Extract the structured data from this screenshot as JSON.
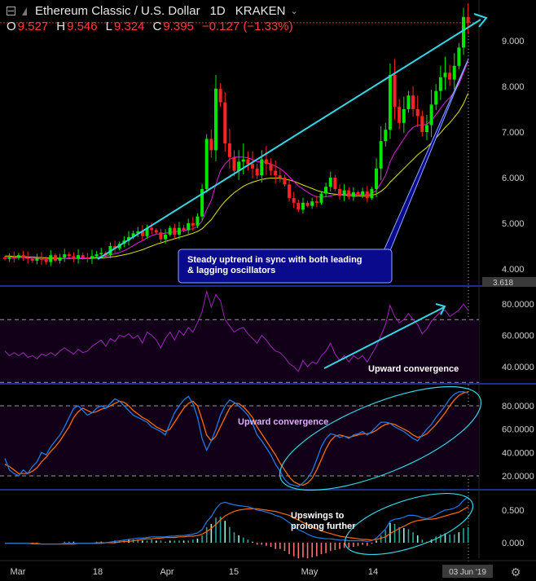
{
  "header": {
    "symbol_title": "Ethereum Classic / U.S. Dollar",
    "timeframe": "1D",
    "exchange": "KRAKEN",
    "ohlc": {
      "o_label": "O",
      "o_value": "9.527",
      "h_label": "H",
      "h_value": "9.546",
      "l_label": "L",
      "l_value": "9.324",
      "c_label": "C",
      "c_value": "9.395",
      "change": "−0.127 (−1.33%)"
    }
  },
  "colors": {
    "up": "#00e600",
    "down": "#ff2222",
    "trendline": "#33d6e6",
    "ma_fast": "#e020e0",
    "ma_slow": "#e6e600",
    "oscillator": "#a020c0",
    "stoch_k": "#1e7ae6",
    "stoch_d": "#ff6a00",
    "macd": "#1e7ae6",
    "signal": "#ff6a00",
    "callout_fill": "#0a0a8c",
    "ellipse": "#33d6e6",
    "annotation_text": "#ffffff"
  },
  "annotations": {
    "price_callout": "Steady uptrend in sync with both leading & lagging oscillators",
    "rsi_note": "Upward convergence",
    "stoch_note": "Upward convergence",
    "macd_note": "Upswings to prolong further"
  },
  "chart_data": [
    {
      "type": "candlestick",
      "title": "Ethereum Classic / U.S. Dollar",
      "x_tick_labels": [
        "Mar",
        "18",
        "Apr",
        "15",
        "May",
        "14",
        "03 Jun '19"
      ],
      "y_ticks": [
        4.0,
        5.0,
        6.0,
        7.0,
        8.0,
        9.0
      ],
      "y_tick_labels": [
        "4.000",
        "5.000",
        "6.000",
        "7.000",
        "8.000",
        "9.000"
      ],
      "ylim": [
        3.58,
        9.88
      ],
      "highlighted_value": "3.618",
      "close": [
        4.22,
        4.26,
        4.24,
        4.3,
        4.25,
        4.22,
        4.18,
        4.23,
        4.2,
        4.15,
        4.3,
        4.18,
        4.25,
        4.32,
        4.28,
        4.22,
        4.3,
        4.25,
        4.22,
        4.28,
        4.32,
        4.35,
        4.3,
        4.5,
        4.45,
        4.55,
        4.62,
        4.7,
        4.78,
        4.82,
        4.72,
        4.9,
        4.85,
        4.8,
        4.65,
        4.75,
        4.9,
        4.75,
        4.9,
        4.85,
        5.0,
        4.95,
        5.15,
        5.75,
        6.85,
        6.6,
        7.95,
        7.65,
        6.75,
        6.45,
        6.15,
        6.35,
        6.4,
        6.3,
        6.2,
        6.05,
        6.4,
        6.3,
        6.15,
        6.05,
        6.0,
        5.85,
        5.55,
        5.45,
        5.3,
        5.45,
        5.38,
        5.48,
        5.45,
        5.65,
        5.8,
        6.0,
        5.75,
        5.6,
        5.72,
        5.58,
        5.68,
        5.62,
        5.7,
        5.55,
        5.75,
        6.2,
        6.8,
        7.05,
        8.25,
        7.55,
        7.2,
        7.5,
        7.8,
        7.5,
        7.35,
        7.0,
        7.15,
        7.6,
        7.9,
        8.2,
        8.3,
        8.15,
        8.45,
        8.85,
        9.52,
        9.395
      ],
      "series": [
        {
          "name": "MA fast",
          "values": [
            4.25,
            4.25,
            4.24,
            4.25,
            4.25,
            4.24,
            4.23,
            4.23,
            4.22,
            4.21,
            4.22,
            4.22,
            4.22,
            4.23,
            4.24,
            4.23,
            4.24,
            4.24,
            4.24,
            4.25,
            4.26,
            4.27,
            4.28,
            4.31,
            4.33,
            4.36,
            4.4,
            4.45,
            4.51,
            4.57,
            4.62,
            4.68,
            4.73,
            4.76,
            4.77,
            4.78,
            4.8,
            4.81,
            4.83,
            4.84,
            4.86,
            4.88,
            4.93,
            5.05,
            5.3,
            5.5,
            5.85,
            6.15,
            6.3,
            6.4,
            6.45,
            6.45,
            6.45,
            6.43,
            6.4,
            6.35,
            6.35,
            6.33,
            6.3,
            6.25,
            6.2,
            6.12,
            6.02,
            5.92,
            5.82,
            5.75,
            5.68,
            5.62,
            5.58,
            5.57,
            5.58,
            5.6,
            5.62,
            5.63,
            5.64,
            5.64,
            5.64,
            5.63,
            5.63,
            5.63,
            5.65,
            5.72,
            5.88,
            6.05,
            6.35,
            6.55,
            6.7,
            6.85,
            7.0,
            7.1,
            7.15,
            7.15,
            7.17,
            7.25,
            7.38,
            7.52,
            7.65,
            7.75,
            7.88,
            8.05,
            8.3,
            8.55
          ]
        },
        {
          "name": "MA slow",
          "values": [
            4.28,
            4.28,
            4.27,
            4.27,
            4.27,
            4.26,
            4.26,
            4.25,
            4.25,
            4.24,
            4.24,
            4.24,
            4.23,
            4.23,
            4.23,
            4.23,
            4.23,
            4.23,
            4.23,
            4.23,
            4.24,
            4.24,
            4.25,
            4.26,
            4.27,
            4.29,
            4.31,
            4.33,
            4.36,
            4.39,
            4.42,
            4.46,
            4.5,
            4.54,
            4.57,
            4.6,
            4.63,
            4.66,
            4.69,
            4.72,
            4.75,
            4.78,
            4.82,
            4.88,
            4.98,
            5.08,
            5.22,
            5.36,
            5.48,
            5.58,
            5.67,
            5.74,
            5.81,
            5.86,
            5.9,
            5.93,
            5.96,
            5.98,
            5.99,
            5.99,
            5.99,
            5.97,
            5.95,
            5.92,
            5.88,
            5.84,
            5.8,
            5.76,
            5.72,
            5.69,
            5.67,
            5.65,
            5.64,
            5.63,
            5.62,
            5.61,
            5.6,
            5.6,
            5.6,
            5.6,
            5.61,
            5.64,
            5.7,
            5.78,
            5.9,
            6.0,
            6.1,
            6.2,
            6.3,
            6.4,
            6.5,
            6.58,
            6.66,
            6.76,
            6.87,
            6.98,
            7.1,
            7.2,
            7.32,
            7.45,
            7.62,
            7.85
          ]
        }
      ]
    },
    {
      "type": "line",
      "title": "",
      "y_tick_labels": [
        "40.0000",
        "60.0000",
        "80.0000"
      ],
      "ylim": [
        30,
        92
      ],
      "bands": [
        30,
        70
      ],
      "series": [
        {
          "name": "",
          "values": [
            50,
            47,
            49,
            47,
            49,
            46,
            47,
            45,
            48,
            47,
            49,
            47,
            50,
            52,
            50,
            48,
            51,
            49,
            50,
            53,
            55,
            57,
            53,
            58,
            56,
            60,
            59,
            61,
            58,
            60,
            55,
            62,
            60,
            57,
            52,
            58,
            62,
            57,
            63,
            60,
            65,
            62,
            68,
            75,
            88,
            78,
            86,
            82,
            70,
            66,
            62,
            64,
            65,
            61,
            58,
            55,
            60,
            57,
            53,
            50,
            49,
            46,
            42,
            40,
            37,
            44,
            40,
            43,
            42,
            47,
            50,
            55,
            48,
            44,
            47,
            43,
            47,
            45,
            47,
            43,
            48,
            53,
            60,
            67,
            79,
            72,
            68,
            70,
            74,
            70,
            67,
            61,
            64,
            69,
            72,
            75,
            76,
            72,
            74,
            76,
            80,
            76
          ]
        }
      ]
    },
    {
      "type": "line",
      "title": "",
      "y_tick_labels": [
        "20.0000",
        "40.0000",
        "60.0000",
        "80.0000"
      ],
      "ylim": [
        10,
        100
      ],
      "bands": [
        20,
        80
      ],
      "series": [
        {
          "name": "%K",
          "values": [
            35,
            25,
            22,
            20,
            25,
            22,
            28,
            32,
            40,
            38,
            45,
            50,
            55,
            62,
            70,
            78,
            80,
            76,
            72,
            74,
            78,
            80,
            78,
            82,
            86,
            84,
            80,
            76,
            72,
            70,
            68,
            66,
            62,
            60,
            58,
            55,
            65,
            74,
            80,
            85,
            88,
            82,
            70,
            52,
            42,
            50,
            60,
            72,
            80,
            85,
            83,
            80,
            76,
            72,
            65,
            55,
            50,
            44,
            38,
            30,
            24,
            17,
            13,
            12,
            11,
            14,
            18,
            24,
            34,
            45,
            52,
            56,
            55,
            53,
            54,
            52,
            55,
            56,
            58,
            55,
            58,
            62,
            66,
            66,
            65,
            62,
            60,
            58,
            55,
            52,
            50,
            55,
            60,
            64,
            70,
            75,
            80,
            86,
            90,
            92,
            92,
            91
          ]
        },
        {
          "name": "%D",
          "values": [
            30,
            28,
            25,
            22,
            22,
            22,
            24,
            27,
            32,
            36,
            41,
            45,
            50,
            56,
            62,
            70,
            75,
            78,
            76,
            74,
            75,
            77,
            78,
            80,
            82,
            84,
            83,
            80,
            76,
            73,
            70,
            68,
            65,
            62,
            60,
            58,
            60,
            66,
            72,
            78,
            82,
            84,
            80,
            68,
            55,
            50,
            54,
            62,
            70,
            78,
            82,
            82,
            79,
            75,
            70,
            62,
            56,
            50,
            44,
            38,
            31,
            25,
            19,
            15,
            13,
            12,
            14,
            18,
            25,
            34,
            43,
            50,
            54,
            55,
            54,
            53,
            54,
            55,
            56,
            56,
            57,
            59,
            62,
            64,
            65,
            64,
            62,
            60,
            58,
            55,
            53,
            54,
            56,
            60,
            64,
            69,
            74,
            80,
            85,
            89,
            91,
            92
          ]
        }
      ]
    },
    {
      "type": "bar",
      "title": "",
      "y_tick_labels": [
        "0.000",
        "0.500"
      ],
      "ylim": [
        -0.18,
        0.82
      ],
      "series": [
        {
          "name": "MACD",
          "values": [
            -0.01,
            -0.01,
            -0.01,
            -0.01,
            -0.01,
            -0.01,
            -0.02,
            -0.02,
            -0.02,
            -0.02,
            -0.02,
            -0.02,
            -0.02,
            -0.01,
            -0.01,
            -0.01,
            -0.01,
            -0.01,
            -0.01,
            -0.01,
            0.0,
            0.0,
            0.0,
            0.01,
            0.02,
            0.03,
            0.04,
            0.05,
            0.06,
            0.07,
            0.07,
            0.08,
            0.09,
            0.09,
            0.09,
            0.09,
            0.1,
            0.1,
            0.11,
            0.11,
            0.12,
            0.13,
            0.15,
            0.2,
            0.32,
            0.4,
            0.52,
            0.6,
            0.62,
            0.6,
            0.58,
            0.57,
            0.56,
            0.55,
            0.53,
            0.5,
            0.49,
            0.47,
            0.45,
            0.42,
            0.4,
            0.36,
            0.31,
            0.25,
            0.2,
            0.17,
            0.13,
            0.1,
            0.08,
            0.07,
            0.06,
            0.06,
            0.05,
            0.04,
            0.04,
            0.03,
            0.03,
            0.03,
            0.03,
            0.02,
            0.03,
            0.07,
            0.14,
            0.21,
            0.33,
            0.36,
            0.37,
            0.39,
            0.42,
            0.42,
            0.41,
            0.38,
            0.37,
            0.39,
            0.43,
            0.47,
            0.5,
            0.51,
            0.53,
            0.57,
            0.65,
            0.7
          ]
        },
        {
          "name": "Signal",
          "values": [
            -0.01,
            -0.01,
            -0.01,
            -0.01,
            -0.01,
            -0.01,
            -0.01,
            -0.01,
            -0.02,
            -0.02,
            -0.02,
            -0.02,
            -0.02,
            -0.02,
            -0.02,
            -0.02,
            -0.01,
            -0.01,
            -0.01,
            -0.01,
            -0.01,
            -0.01,
            0.0,
            0.0,
            0.0,
            0.01,
            0.02,
            0.02,
            0.03,
            0.04,
            0.05,
            0.06,
            0.06,
            0.07,
            0.07,
            0.08,
            0.08,
            0.08,
            0.09,
            0.09,
            0.1,
            0.1,
            0.11,
            0.13,
            0.17,
            0.22,
            0.28,
            0.35,
            0.41,
            0.45,
            0.48,
            0.5,
            0.51,
            0.52,
            0.52,
            0.52,
            0.51,
            0.5,
            0.49,
            0.48,
            0.46,
            0.44,
            0.42,
            0.38,
            0.35,
            0.31,
            0.28,
            0.24,
            0.21,
            0.18,
            0.16,
            0.14,
            0.12,
            0.1,
            0.09,
            0.08,
            0.07,
            0.06,
            0.05,
            0.05,
            0.04,
            0.05,
            0.07,
            0.09,
            0.14,
            0.18,
            0.22,
            0.25,
            0.29,
            0.32,
            0.34,
            0.35,
            0.36,
            0.36,
            0.37,
            0.39,
            0.41,
            0.43,
            0.45,
            0.47,
            0.51,
            0.55
          ]
        }
      ]
    }
  ]
}
